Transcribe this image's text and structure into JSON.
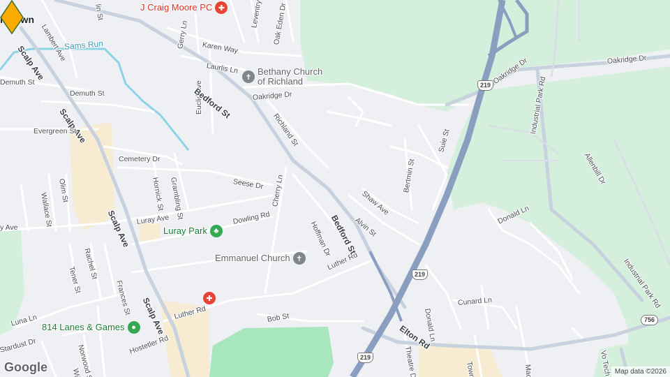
{
  "colors": {
    "background": "#eef0f3",
    "green_area": "#d4f0dd",
    "park": "#a8e6bd",
    "commercial": "#f7ecd2",
    "road": "#ffffff",
    "arterial": "#c8d2de",
    "highway": "#8a9fbf",
    "water": "#8dd3e6",
    "pin": "#f9ab00",
    "pin_stroke": "#3d6e2c",
    "church_icon": "#80868b",
    "medical_icon": "#ea4335",
    "park_icon": "#34a853",
    "label_text": "#4a4f55",
    "water_text": "#3a9bb8"
  },
  "pois": {
    "craig_moore": {
      "label": "J Craig Moore PC",
      "icon": "medical-cross-icon",
      "color": "#d93025"
    },
    "bethany": {
      "line1": "Bethany Church",
      "line2": "of Richland",
      "icon": "church-cross-icon",
      "color": "#5f6368"
    },
    "luray_park": {
      "label": "Luray Park",
      "icon": "tree-icon",
      "color": "#188038"
    },
    "emmanuel": {
      "label": "Emmanuel Church",
      "icon": "church-cross-icon",
      "color": "#5f6368"
    },
    "lanes": {
      "label": "814 Lanes & Games",
      "icon": "location-dot-icon",
      "color": "#188038"
    },
    "medical_unlabeled": {
      "icon": "medical-cross-icon"
    }
  },
  "places": {
    "town_partial": "nstown"
  },
  "water": {
    "sams_run": "Sams Run"
  },
  "streets": {
    "lambert": "Lambert Ave",
    "scalp1": "Scalp Ave",
    "scalp2": "Scalp Ave",
    "scalp3": "Scalp Ave",
    "scalp4": "Scalp Ave",
    "demuth1": "Demuth St",
    "demuth2": "Demuth St",
    "evergreen": "Evergreen St",
    "cemetery": "Cemetery Dr",
    "hornick": "Hornick St",
    "grambling": "Grambling St",
    "wallace": "Wallace St",
    "olim": "Olim St",
    "luray": "Luray Ave",
    "ave_partial": "y Ave",
    "dowling": "Dowling Rd",
    "rachel": "Rachel St",
    "tener": "Tener St",
    "frances": "Frances St",
    "luna": "Luna Ln",
    "stardust": "Stardust Dr",
    "norwood": "Norwood St",
    "hostetler": "Hostetler Rd",
    "wine": "Wine",
    "luther1": "Luther Rd",
    "luther2": "Luther Rd",
    "bob": "Bob St",
    "cherry": "Cherry Ln",
    "hoffman": "Hoffman Dr",
    "seese": "Seese Dr",
    "euclid": "Euclid Ave",
    "gerry": "Gerry Ln",
    "karen": "Karen Way",
    "laurlis": "Laurlis Ln",
    "bedford1": "Bedford St",
    "bedford2": "Bedford St",
    "richland": "Richland St",
    "oakridge1": "Oakridge Dr",
    "oakridge2": "Oakridge Dr",
    "oakridge3": "Oakridge Dr",
    "oak_eden": "Oak Eden Dr",
    "leventry": "Leventry R",
    "lin_partial": "lin St",
    "shaw": "Shaw Ave",
    "alvin": "Alvin St",
    "bertmin": "Bertmin St",
    "suie": "Suie St",
    "industrial1": "Industrial Park Rd",
    "industrial2": "Industrial Park Rd",
    "allenbill": "Allenbill Dr",
    "donald_ln": "Donald Ln",
    "donald_ln2": "Donald Ln",
    "cunard": "Cunard Ln",
    "elton": "Elton Rd",
    "theatre": "Theatre Dr",
    "town_partial": "Town C",
    "macr": "Macr",
    "vo_tech": "Vo Tech"
  },
  "shields": {
    "us219_a": "219",
    "us219_b": "219",
    "us219_c": "219",
    "rt756": "756"
  },
  "logo": "Google",
  "attribution": "Map data ©2026",
  "pin": {
    "label": "selected-location",
    "color": "#f9ab00"
  }
}
